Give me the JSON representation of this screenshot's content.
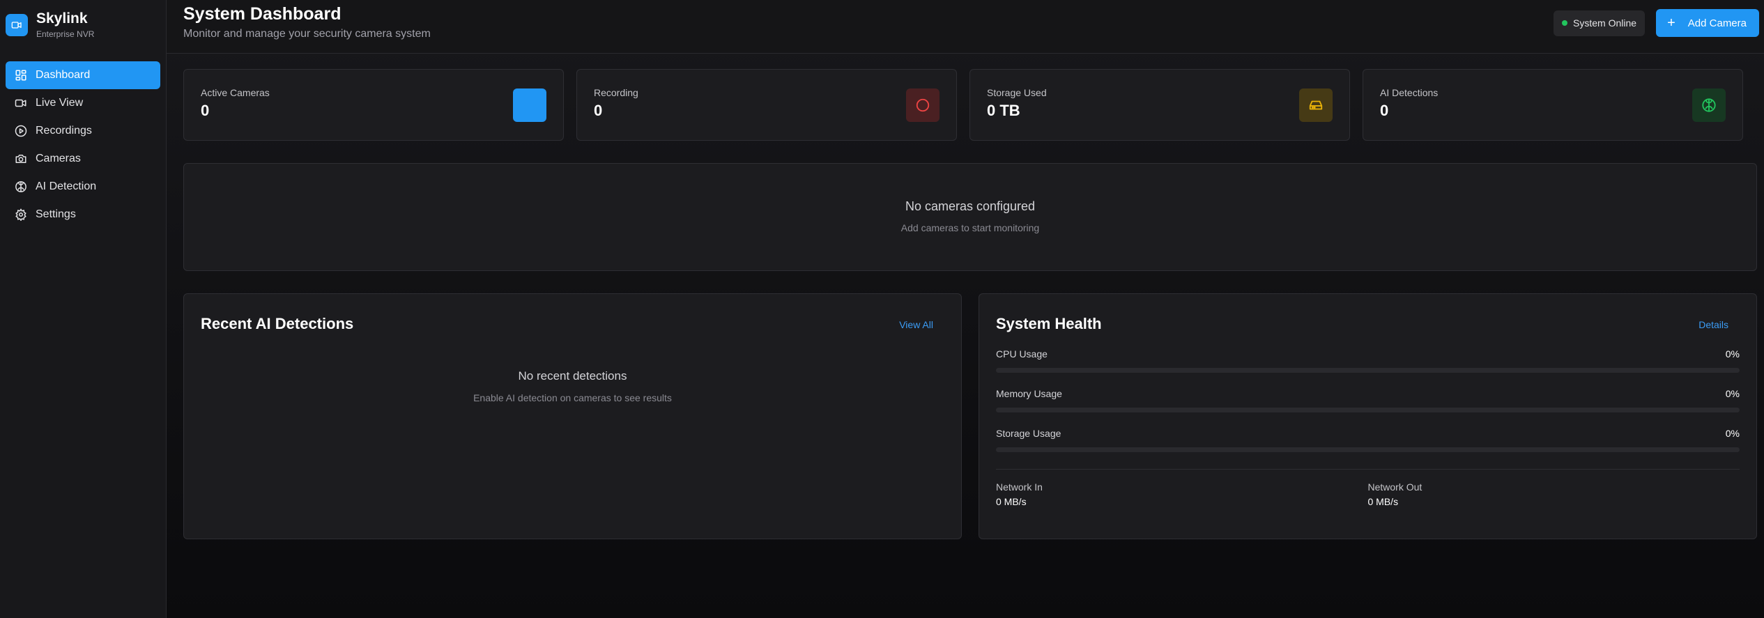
{
  "brand": {
    "name": "Skylink",
    "subtitle": "Enterprise NVR",
    "logo_icon": "video-camera-icon"
  },
  "sidebar": {
    "items": [
      {
        "label": "Dashboard",
        "icon": "dashboard-icon",
        "active": true
      },
      {
        "label": "Live View",
        "icon": "video-icon",
        "active": false
      },
      {
        "label": "Recordings",
        "icon": "play-circle-icon",
        "active": false
      },
      {
        "label": "Cameras",
        "icon": "camera-icon",
        "active": false
      },
      {
        "label": "AI Detection",
        "icon": "brain-icon",
        "active": false
      },
      {
        "label": "Settings",
        "icon": "gear-icon",
        "active": false
      }
    ]
  },
  "header": {
    "title": "System Dashboard",
    "subtitle": "Monitor and manage your security camera system",
    "status": "System Online",
    "add_button": "Add Camera"
  },
  "stats": [
    {
      "label": "Active Cameras",
      "value": "0",
      "icon": "camera-icon",
      "color": "#2196f3"
    },
    {
      "label": "Recording",
      "value": "0",
      "icon": "record-circle-icon",
      "color": "#ef4444"
    },
    {
      "label": "Storage Used",
      "value": "0 TB",
      "icon": "hard-drive-icon",
      "color": "#eab308"
    },
    {
      "label": "AI Detections",
      "value": "0",
      "icon": "brain-icon",
      "color": "#22c55e"
    }
  ],
  "cameras_empty": {
    "title": "No cameras configured",
    "subtitle": "Add cameras to start monitoring"
  },
  "detections": {
    "title": "Recent AI Detections",
    "link": "View All",
    "empty_title": "No recent detections",
    "empty_subtitle": "Enable AI detection on cameras to see results"
  },
  "health": {
    "title": "System Health",
    "link": "Details",
    "metrics": [
      {
        "label": "CPU Usage",
        "value": "0%",
        "percent": 0
      },
      {
        "label": "Memory Usage",
        "value": "0%",
        "percent": 0
      },
      {
        "label": "Storage Usage",
        "value": "0%",
        "percent": 0
      }
    ],
    "network_in": {
      "label": "Network In",
      "value": "0 MB/s"
    },
    "network_out": {
      "label": "Network Out",
      "value": "0 MB/s"
    }
  },
  "colors": {
    "accent": "#2196f3",
    "online": "#22c55e"
  }
}
